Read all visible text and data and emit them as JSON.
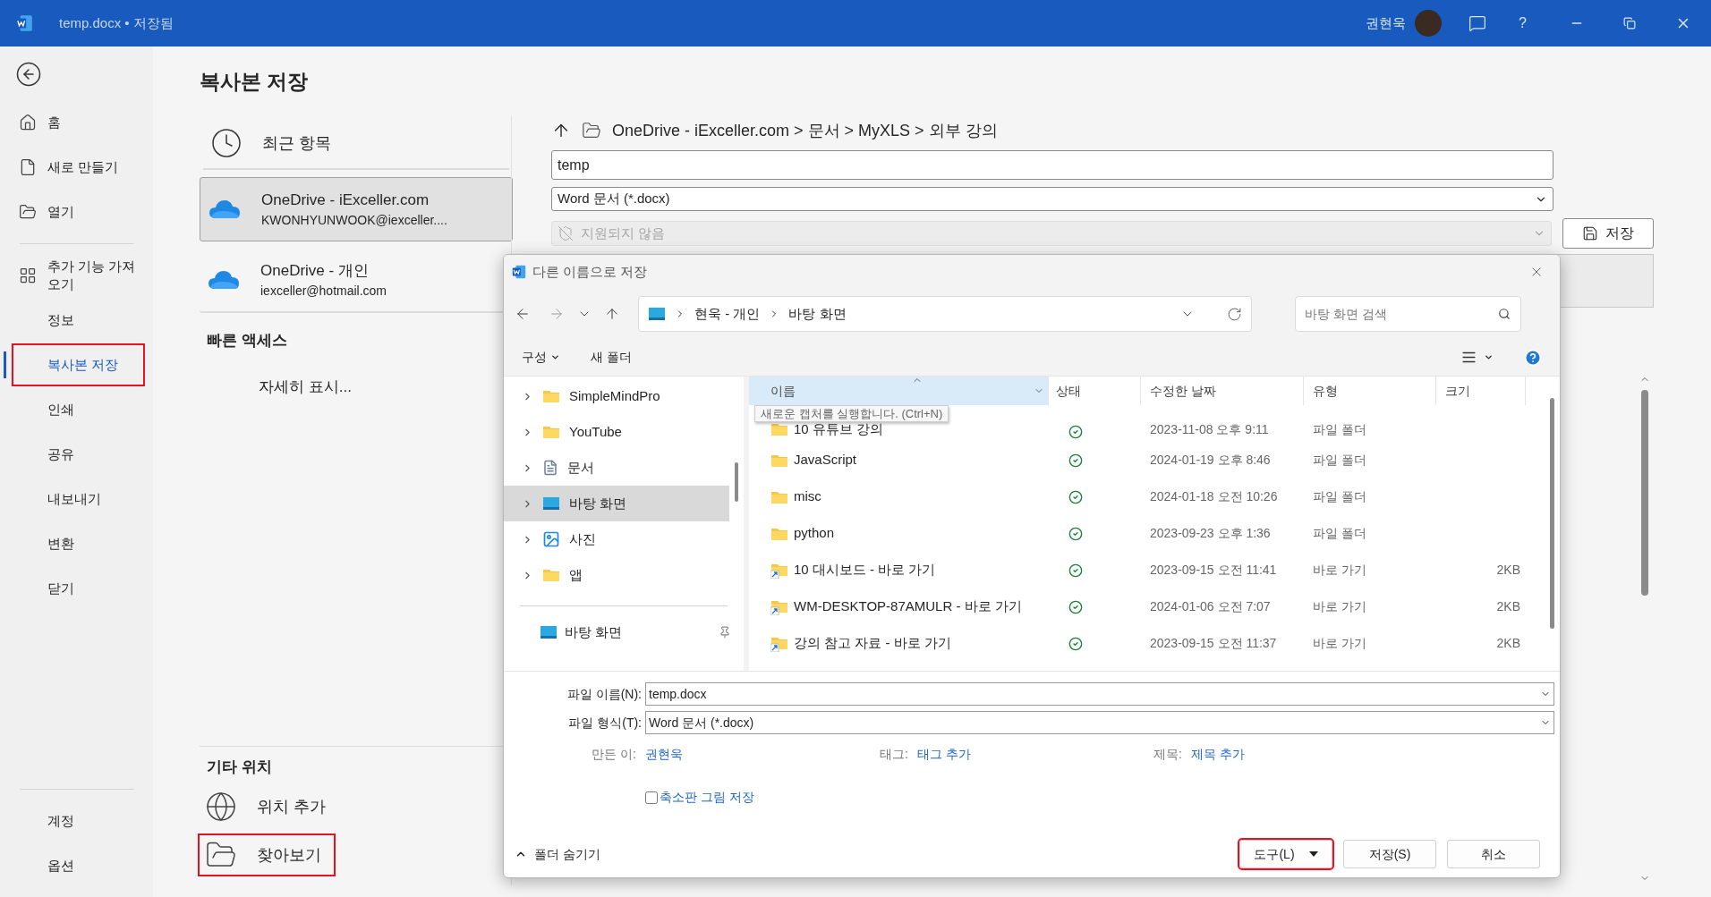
{
  "title_bar": {
    "title": "temp.docx • 저장됨",
    "user": "권현욱",
    "help": "?"
  },
  "sidebar": {
    "groups": [
      {
        "items": [
          {
            "label": "홈",
            "kind": "home",
            "selected": false,
            "highlighted": false
          },
          {
            "label": "새로 만들기",
            "kind": "new",
            "selected": false,
            "highlighted": false
          },
          {
            "label": "열기",
            "kind": "open",
            "selected": false,
            "highlighted": false
          }
        ]
      },
      {
        "items": [
          {
            "label": "추가 기능 가져오기",
            "kind": "addins",
            "selected": false,
            "highlighted": false
          },
          {
            "label": "정보",
            "kind": "text",
            "selected": false,
            "highlighted": false
          },
          {
            "label": "복사본 저장",
            "kind": "text",
            "selected": true,
            "highlighted": true
          },
          {
            "label": "인쇄",
            "kind": "text",
            "selected": false,
            "highlighted": false
          },
          {
            "label": "공유",
            "kind": "text",
            "selected": false,
            "highlighted": false
          },
          {
            "label": "내보내기",
            "kind": "text",
            "selected": false,
            "highlighted": false
          },
          {
            "label": "변환",
            "kind": "text",
            "selected": false,
            "highlighted": false
          },
          {
            "label": "닫기",
            "kind": "text",
            "selected": false,
            "highlighted": false
          }
        ]
      },
      {
        "items": [
          {
            "label": "계정",
            "kind": "text",
            "selected": false,
            "highlighted": false
          },
          {
            "label": "옵션",
            "kind": "text",
            "selected": false,
            "highlighted": false
          }
        ]
      }
    ]
  },
  "heading": "복사본 저장",
  "places": {
    "recent": "최근 항목",
    "accounts": [
      {
        "title": "OneDrive - iExceller.com",
        "subtitle": "KWONHYUNWOOK@iexceller....",
        "selected": true
      },
      {
        "title": "OneDrive - 개인",
        "subtitle": "iexceller@hotmail.com",
        "selected": false
      }
    ],
    "quick_access": {
      "heading": "빠른 액세스",
      "more": "자세히 표시..."
    },
    "other": {
      "heading": "기타 위치",
      "items": [
        {
          "label": "위치 추가",
          "kind": "add",
          "highlighted": false
        },
        {
          "label": "찾아보기",
          "kind": "browse",
          "highlighted": true
        }
      ]
    }
  },
  "save_panel": {
    "path": "OneDrive - iExceller.com > 문서 > MyXLS > 외부 강의",
    "file_name": "temp",
    "file_type": "Word 문서 (*.docx)",
    "sensitivity": {
      "value": "지원되지 않음",
      "disabled": true
    },
    "save_button": "저장"
  },
  "dialog": {
    "title": "다른 이름으로 저장",
    "address": [
      "현욱 - 개인",
      "바탕 화면"
    ],
    "search_placeholder": "바탕 화면 검색",
    "organize": "구성",
    "new_folder": "새 폴더",
    "tree": [
      {
        "label": "SimpleMindPro",
        "kind": "folder",
        "selected": false
      },
      {
        "label": "YouTube",
        "kind": "folder",
        "selected": false
      },
      {
        "label": "문서",
        "kind": "docs",
        "selected": false
      },
      {
        "label": "바탕 화면",
        "kind": "desktop",
        "selected": true
      },
      {
        "label": "사진",
        "kind": "photos",
        "selected": false
      },
      {
        "label": "앱",
        "kind": "folder",
        "selected": false
      }
    ],
    "pinned": {
      "label": "바탕 화면"
    },
    "columns": [
      "이름",
      "상태",
      "수정한 날짜",
      "유형",
      "크기"
    ],
    "tooltip": "새로운 캡처를 실행합니다. (Ctrl+N)",
    "rows": [
      {
        "name": "10 유튜브 강의",
        "kind": "folder",
        "synced": true,
        "date": "2023-11-08 오후 9:11",
        "type": "파일 폴더"
      },
      {
        "name": "JavaScript",
        "kind": "folder",
        "synced": true,
        "date": "2024-01-19 오후 8:46",
        "type": "파일 폴더"
      },
      {
        "name": "misc",
        "kind": "folder",
        "synced": true,
        "date": "2024-01-18 오전 10:26",
        "type": "파일 폴더"
      },
      {
        "name": "python",
        "kind": "folder",
        "synced": true,
        "date": "2023-09-23 오후 1:36",
        "type": "파일 폴더"
      },
      {
        "name": "10 대시보드 - 바로 가기",
        "kind": "shortcut",
        "synced": true,
        "date": "2023-09-15 오전 11:41",
        "type": "바로 가기",
        "size": "2KB"
      },
      {
        "name": "WM-DESKTOP-87AMULR - 바로 가기",
        "kind": "shortcut",
        "synced": true,
        "date": "2024-01-06 오전 7:07",
        "type": "바로 가기",
        "size": "2KB"
      },
      {
        "name": "강의 참고 자료 - 바로 가기",
        "kind": "shortcut",
        "synced": true,
        "date": "2023-09-15 오전 11:37",
        "type": "바로 가기",
        "size": "2KB"
      }
    ],
    "file_name": {
      "label": "파일 이름(N):",
      "value": "temp.docx"
    },
    "file_type": {
      "label": "파일 형식(T):",
      "value": "Word 문서 (*.docx)"
    },
    "meta": [
      {
        "label": "만든 이:",
        "value": "권현욱"
      },
      {
        "label": "태그:",
        "value": "태그 추가"
      },
      {
        "label": "제목:",
        "value": "제목 추가"
      }
    ],
    "thumbnail": {
      "label": "축소판 그림 저장",
      "checked": false
    },
    "hide_folders": "폴더 숨기기",
    "buttons": [
      {
        "label": "도구(L)",
        "kind": "menu",
        "highlighted": true
      },
      {
        "label": "저장(S)",
        "kind": "plain",
        "highlighted": false
      },
      {
        "label": "취소",
        "kind": "plain",
        "highlighted": false
      }
    ]
  }
}
